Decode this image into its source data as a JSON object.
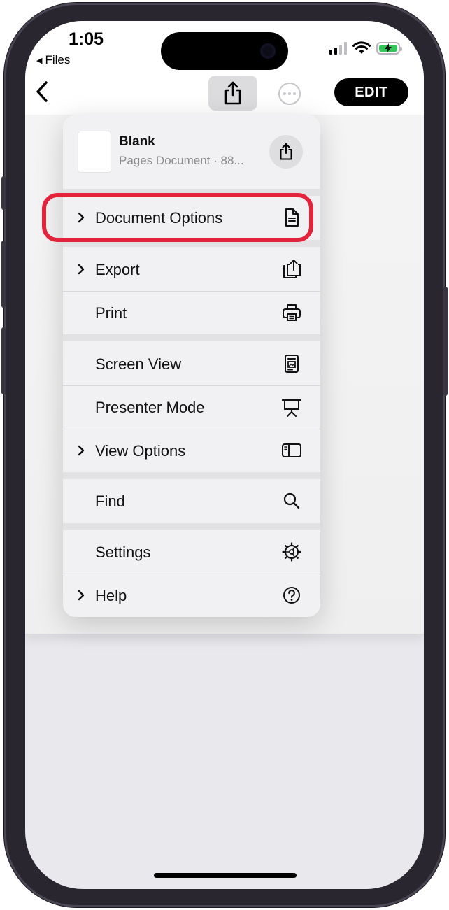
{
  "status_bar": {
    "time": "1:05",
    "back_app": "Files"
  },
  "toolbar": {
    "edit_label": "EDIT"
  },
  "menu": {
    "document": {
      "title": "Blank",
      "subtitle": "Pages Document · 88..."
    },
    "items": [
      {
        "label": "Document Options",
        "has_submenu": true,
        "icon": "document-icon",
        "highlighted": true
      },
      {
        "label": "Export",
        "has_submenu": true,
        "icon": "export-icon"
      },
      {
        "label": "Print",
        "has_submenu": false,
        "icon": "printer-icon"
      },
      {
        "label": "Screen View",
        "has_submenu": false,
        "icon": "screen-view-icon"
      },
      {
        "label": "Presenter Mode",
        "has_submenu": false,
        "icon": "presenter-icon"
      },
      {
        "label": "View Options",
        "has_submenu": true,
        "icon": "sidebar-icon"
      },
      {
        "label": "Find",
        "has_submenu": false,
        "icon": "search-icon"
      },
      {
        "label": "Settings",
        "has_submenu": false,
        "icon": "gear-icon"
      },
      {
        "label": "Help",
        "has_submenu": true,
        "icon": "help-icon"
      }
    ]
  },
  "colors": {
    "highlight": "#e3223c",
    "battery": "#33c759"
  }
}
